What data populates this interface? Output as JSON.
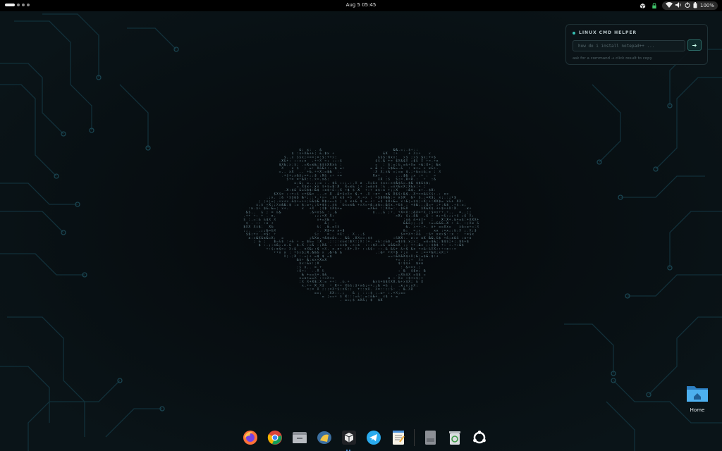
{
  "topbar": {
    "datetime": "Aug 5  05:45",
    "battery_label": "100%",
    "tray_icons": [
      "package-icon",
      "lock-icon",
      "wifi-icon",
      "volume-icon",
      "power-icon",
      "battery-icon"
    ]
  },
  "widget": {
    "title": "LINUX CMD HELPER",
    "input_placeholder": "how do i install notepad++ ...",
    "run_button_label": "➔",
    "hint": "ask for a command → click result to copy"
  },
  "desktop": {
    "home_label": "Home"
  },
  "dock": {
    "items": [
      "firefox",
      "chrome",
      "files",
      "app-grid-launcher",
      "virtualbox",
      "telegram",
      "text-editor",
      "csv-viewer",
      "trash",
      "ubuntu-menu"
    ]
  },
  "colors": {
    "accent": "#35c0b3",
    "folder": "#3aa3e6",
    "ascii": "#7fa2ad"
  }
}
